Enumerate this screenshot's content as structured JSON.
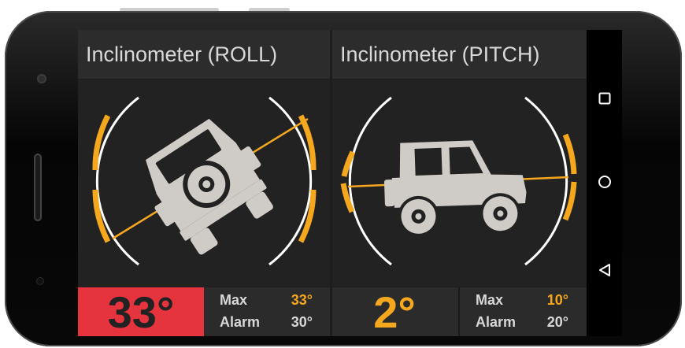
{
  "panels": [
    {
      "title": "Inclinometer (ROLL)",
      "value": "33°",
      "max_label": "Max",
      "max_value": "33°",
      "alarm_label": "Alarm",
      "alarm_value": "30°",
      "state": "alarm",
      "vehicle_icon": "jeep-rear-icon"
    },
    {
      "title": "Inclinometer (PITCH)",
      "value": "2°",
      "max_label": "Max",
      "max_value": "10°",
      "alarm_label": "Alarm",
      "alarm_value": "20°",
      "state": "normal",
      "vehicle_icon": "jeep-side-icon"
    }
  ],
  "nav": {
    "items": [
      "recents-square-icon",
      "home-circle-icon",
      "back-triangle-icon"
    ]
  },
  "colors": {
    "accent": "#f5a71e",
    "alarm_bg": "#e5343d",
    "panel_bg": "#222222",
    "title_bg": "#2c2c2c",
    "text": "#d8d8d8",
    "icon": "#cfcbc7"
  }
}
